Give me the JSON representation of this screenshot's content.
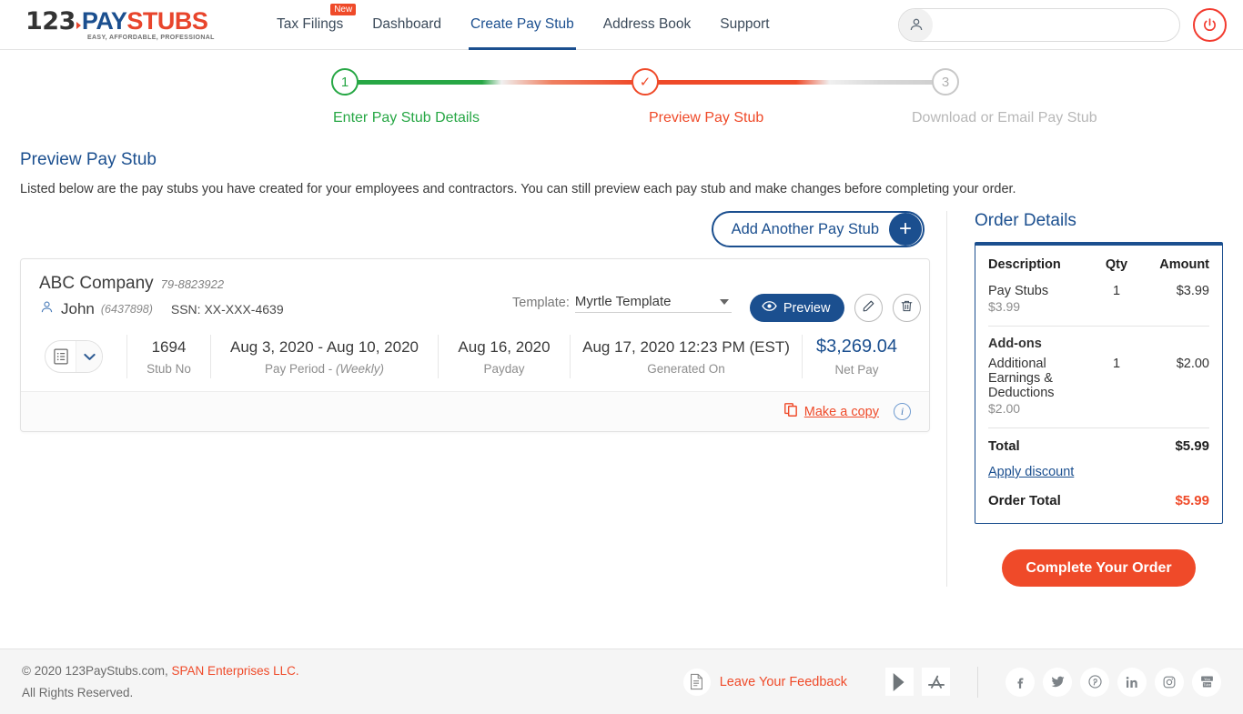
{
  "brand": {
    "logo_123": "123",
    "logo_pay": "PAY",
    "logo_stubs": "STUBS",
    "logo_tagline": "EASY, AFFORDABLE, PROFESSIONAL",
    "navy": "#1b4f8f",
    "orange": "#ef4a29",
    "green": "#27a745"
  },
  "nav": {
    "items": [
      {
        "label": "Tax Filings",
        "badge": "New",
        "active": false
      },
      {
        "label": "Dashboard",
        "badge": "",
        "active": false
      },
      {
        "label": "Create Pay Stub",
        "badge": "",
        "active": true
      },
      {
        "label": "Address Book",
        "badge": "",
        "active": false
      },
      {
        "label": "Support",
        "badge": "",
        "active": false
      }
    ],
    "user_account_value": "",
    "user_icon": "person-icon",
    "power_icon": "power-icon"
  },
  "stepper": {
    "steps": [
      {
        "number": "1",
        "label": "Enter Pay Stub Details",
        "state": "complete"
      },
      {
        "number": "✓",
        "label": "Preview Pay Stub",
        "state": "current"
      },
      {
        "number": "3",
        "label": "Download or Email Pay Stub",
        "state": "upcoming"
      }
    ]
  },
  "page": {
    "title": "Preview Pay Stub",
    "description": "Listed below are the pay stubs you have created for your employees and contractors. You can still preview each pay stub and make changes before completing your order."
  },
  "actions": {
    "add_another": "Add Another Pay Stub",
    "add_plus": "+"
  },
  "stub": {
    "company_name": "ABC Company",
    "company_ein": "79-8823922",
    "employee_name": "John",
    "employee_id": "(6437898)",
    "employee_ssn": "SSN: XX-XXX-4639",
    "template_label": "Template:",
    "template_value": "Myrtle Template",
    "preview_label": "Preview",
    "edit_icon": "pencil-icon",
    "delete_icon": "trash-icon",
    "list_icon": "list-icon",
    "stats": [
      {
        "value": "1694",
        "label": "Stub No",
        "label_em": ""
      },
      {
        "value": "Aug 3, 2020 - Aug 10, 2020",
        "label": "Pay Period - ",
        "label_em": "(Weekly)"
      },
      {
        "value": "Aug 16, 2020",
        "label": "Payday",
        "label_em": ""
      },
      {
        "value": "Aug 17, 2020 12:23 PM (EST)",
        "label": "Generated On",
        "label_em": ""
      },
      {
        "value": "$3,269.04",
        "label": "Net Pay",
        "label_em": ""
      }
    ],
    "make_a_copy": "Make a copy",
    "info_icon": "info-icon"
  },
  "order": {
    "title": "Order Details",
    "columns": {
      "description": "Description",
      "qty": "Qty",
      "amount": "Amount"
    },
    "items": [
      {
        "name": "Pay Stubs",
        "unit_price": "$3.99",
        "qty": "1",
        "amount": "$3.99"
      }
    ],
    "addons_header": "Add-ons",
    "addons": [
      {
        "name": "Additional Earnings & Deductions",
        "unit_price": "$2.00",
        "qty": "1",
        "amount": "$2.00"
      }
    ],
    "total_label": "Total",
    "total_amount": "$5.99",
    "apply_discount": "Apply discount",
    "order_total_label": "Order Total",
    "order_total_amount": "$5.99",
    "complete_button": "Complete Your Order"
  },
  "footer": {
    "copyright_prefix": "© 2020 123PayStubs.com, ",
    "copyright_link": "SPAN Enterprises LLC.",
    "rights": "All Rights Reserved.",
    "feedback": "Leave Your Feedback",
    "feedback_icon": "feedback-document-icon",
    "store_icons": [
      "google-play-icon",
      "app-store-icon"
    ],
    "socials": [
      "facebook-icon",
      "twitter-icon",
      "pinterest-icon",
      "linkedin-icon",
      "instagram-icon",
      "youtube-icon"
    ]
  }
}
